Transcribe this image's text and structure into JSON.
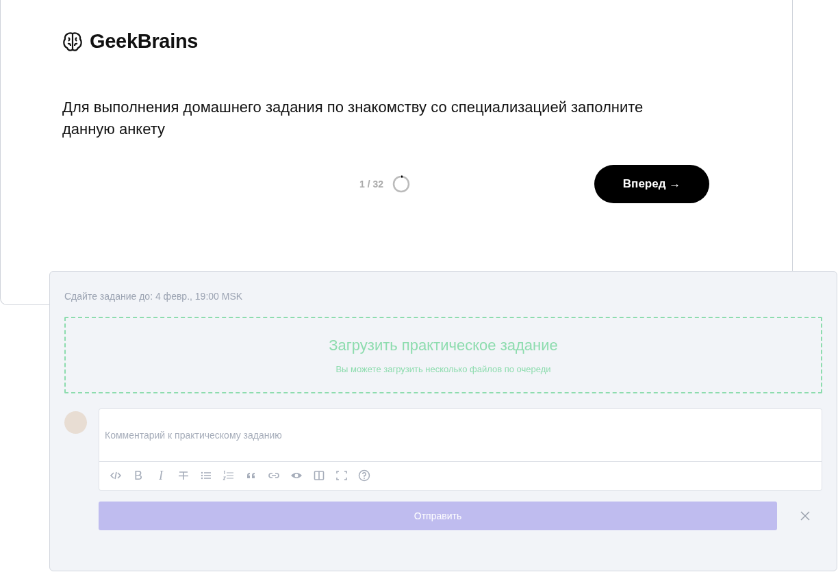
{
  "survey_card": {
    "logo": "GeekBrains",
    "question": "Для выполнения домашнего задания по знакомству со специализацией заполните данную анкету",
    "progress": {
      "counter": "1 / 32",
      "level": 0.03
    },
    "next_button": "Вперед →"
  },
  "homework_card": {
    "deadline": "Сдайте задание до: 4 февр., 19:00 MSK",
    "upload": {
      "title": "Загрузить практическое задание",
      "hint": "Вы можете загрузить несколько файлов по очереди"
    },
    "comment": {
      "placeholder": "Комментарий к практическому заданию",
      "toolbar": [
        {
          "kind": "code"
        },
        {
          "kind": "bold",
          "text": "B"
        },
        {
          "kind": "italic",
          "text": "I"
        },
        {
          "kind": "strike"
        },
        {
          "kind": "bullets"
        },
        {
          "kind": "numbered"
        },
        {
          "kind": "quote"
        },
        {
          "kind": "link"
        },
        {
          "kind": "preview"
        },
        {
          "kind": "columns"
        },
        {
          "kind": "fullscreen"
        },
        {
          "kind": "help"
        }
      ]
    },
    "submit": {
      "label": "Отправить",
      "disabled": true
    }
  }
}
